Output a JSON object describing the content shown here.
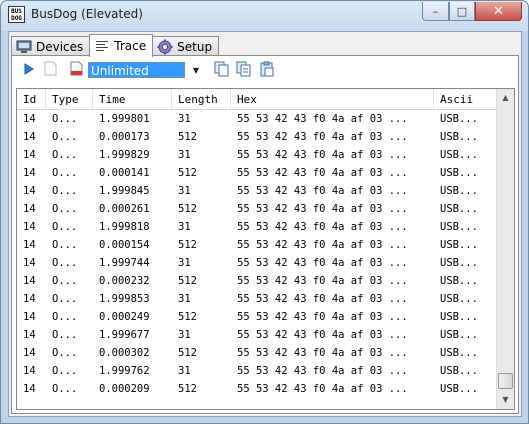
{
  "window": {
    "title": "BusDog (Elevated)",
    "app_icon_text": "BUS\nDOG",
    "minimize_glyph": "–",
    "maximize_glyph": "□",
    "close_glyph": "✕"
  },
  "tabs": [
    {
      "label": "Devices",
      "icon": "devices-icon",
      "active": false
    },
    {
      "label": "Trace",
      "icon": "list-lines-icon",
      "active": true
    },
    {
      "label": "Setup",
      "icon": "gear-icon",
      "active": false
    }
  ],
  "toolbar": {
    "buffer_limit_value": "Unlimited",
    "buttons": [
      "play-icon",
      "new-page-icon",
      "clear-icon",
      "copy-icon",
      "copy-all-icon",
      "paste-icon"
    ]
  },
  "columns": [
    "Id",
    "Type",
    "Time",
    "Length",
    "Hex",
    "Ascii"
  ],
  "rows": [
    {
      "id": "14",
      "type": "O...",
      "time": "1.999801",
      "length": "31",
      "hex": "55 53 42 43 f0 4a af 03 ...",
      "ascii": "USB..."
    },
    {
      "id": "14",
      "type": "O...",
      "time": "0.000173",
      "length": "512",
      "hex": "55 53 42 43 f0 4a af 03 ...",
      "ascii": "USB..."
    },
    {
      "id": "14",
      "type": "O...",
      "time": "1.999829",
      "length": "31",
      "hex": "55 53 42 43 f0 4a af 03 ...",
      "ascii": "USB..."
    },
    {
      "id": "14",
      "type": "O...",
      "time": "0.000141",
      "length": "512",
      "hex": "55 53 42 43 f0 4a af 03 ...",
      "ascii": "USB..."
    },
    {
      "id": "14",
      "type": "O...",
      "time": "1.999845",
      "length": "31",
      "hex": "55 53 42 43 f0 4a af 03 ...",
      "ascii": "USB..."
    },
    {
      "id": "14",
      "type": "O...",
      "time": "0.000261",
      "length": "512",
      "hex": "55 53 42 43 f0 4a af 03 ...",
      "ascii": "USB..."
    },
    {
      "id": "14",
      "type": "O...",
      "time": "1.999818",
      "length": "31",
      "hex": "55 53 42 43 f0 4a af 03 ...",
      "ascii": "USB..."
    },
    {
      "id": "14",
      "type": "O...",
      "time": "0.000154",
      "length": "512",
      "hex": "55 53 42 43 f0 4a af 03 ...",
      "ascii": "USB..."
    },
    {
      "id": "14",
      "type": "O...",
      "time": "1.999744",
      "length": "31",
      "hex": "55 53 42 43 f0 4a af 03 ...",
      "ascii": "USB..."
    },
    {
      "id": "14",
      "type": "O...",
      "time": "0.000232",
      "length": "512",
      "hex": "55 53 42 43 f0 4a af 03 ...",
      "ascii": "USB..."
    },
    {
      "id": "14",
      "type": "O...",
      "time": "1.999853",
      "length": "31",
      "hex": "55 53 42 43 f0 4a af 03 ...",
      "ascii": "USB..."
    },
    {
      "id": "14",
      "type": "O...",
      "time": "0.000249",
      "length": "512",
      "hex": "55 53 42 43 f0 4a af 03 ...",
      "ascii": "USB..."
    },
    {
      "id": "14",
      "type": "O...",
      "time": "1.999677",
      "length": "31",
      "hex": "55 53 42 43 f0 4a af 03 ...",
      "ascii": "USB..."
    },
    {
      "id": "14",
      "type": "O...",
      "time": "0.000302",
      "length": "512",
      "hex": "55 53 42 43 f0 4a af 03 ...",
      "ascii": "USB..."
    },
    {
      "id": "14",
      "type": "O...",
      "time": "1.999762",
      "length": "31",
      "hex": "55 53 42 43 f0 4a af 03 ...",
      "ascii": "USB..."
    },
    {
      "id": "14",
      "type": "O...",
      "time": "0.000209",
      "length": "512",
      "hex": "55 53 42 43 f0 4a af 03 ...",
      "ascii": "USB..."
    }
  ],
  "scrollbar": {
    "up_glyph": "▲",
    "down_glyph": "▼",
    "position": 0.95
  },
  "colors": {
    "selection": "#3399ff",
    "close_button": "#c75050",
    "frame": "#bed3ea"
  }
}
